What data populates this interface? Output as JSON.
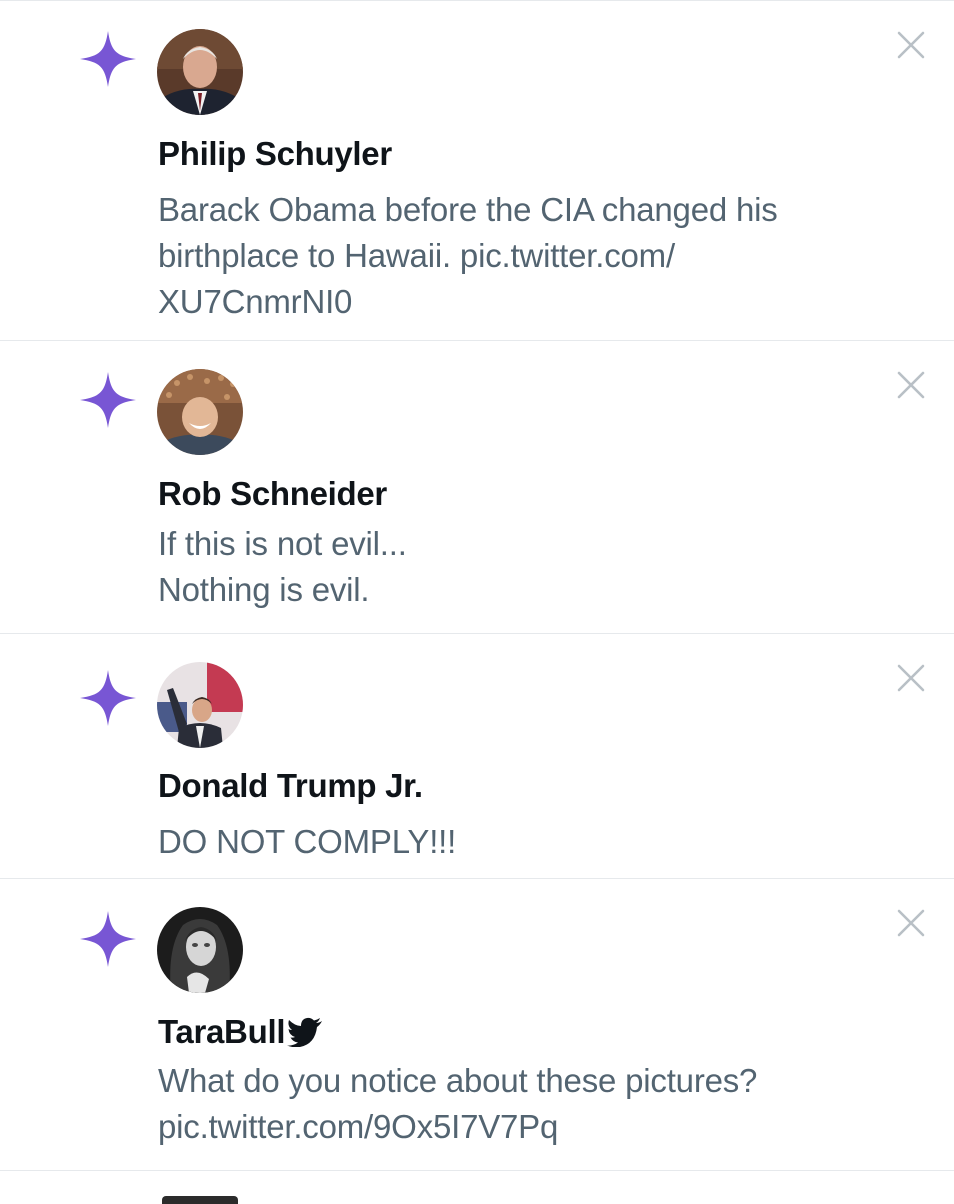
{
  "notifications": [
    {
      "name": "Philip Schuyler",
      "text": "Barack Obama before the CIA changed his\nbirthplace to Hawaii. pic.twitter.com/\nXU7CnmrNI0",
      "icon": "sparkle-icon",
      "avatar": "avatar-suited-man"
    },
    {
      "name": "Rob Schneider",
      "text": "If this is not evil...\nNothing is evil.",
      "icon": "sparkle-icon",
      "avatar": "avatar-smiling-man-crowd"
    },
    {
      "name": "Donald Trump Jr.",
      "text": "DO NOT COMPLY!!!",
      "icon": "sparkle-icon",
      "avatar": "avatar-man-at-podium"
    },
    {
      "name": "TaraBull",
      "text": "What do you notice about these pictures?\npic.twitter.com/9Ox5I7V7Pq",
      "icon": "sparkle-icon",
      "avatar": "avatar-woman-bw",
      "badge": "bird-icon"
    }
  ],
  "colors": {
    "sparkle": "#7856d4",
    "name": "#0f1419",
    "text": "#536471",
    "divider": "#e6e9ec",
    "close": "#b9c0c6"
  }
}
